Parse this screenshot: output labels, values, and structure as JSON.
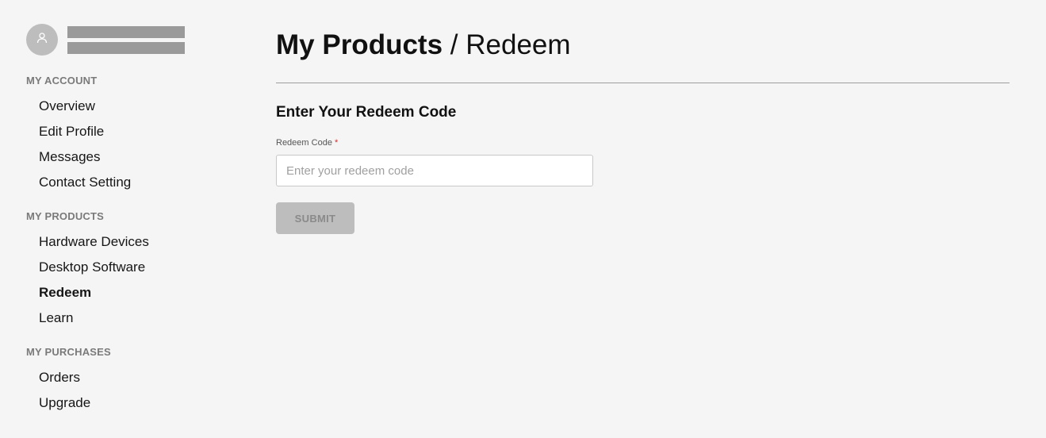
{
  "header": {
    "title_primary": "My Products",
    "title_separator": " / ",
    "title_secondary": "Redeem"
  },
  "sidebar": {
    "user": {
      "avatar_icon": "user-icon"
    },
    "sections": [
      {
        "heading": "MY ACCOUNT",
        "items": [
          {
            "label": "Overview"
          },
          {
            "label": "Edit Profile"
          },
          {
            "label": "Messages"
          },
          {
            "label": "Contact Setting"
          }
        ]
      },
      {
        "heading": "MY PRODUCTS",
        "items": [
          {
            "label": "Hardware Devices"
          },
          {
            "label": "Desktop Software"
          },
          {
            "label": "Redeem",
            "active": true
          },
          {
            "label": "Learn"
          }
        ]
      },
      {
        "heading": "MY PURCHASES",
        "items": [
          {
            "label": "Orders"
          },
          {
            "label": "Upgrade"
          }
        ]
      }
    ]
  },
  "form": {
    "title": "Enter Your Redeem Code",
    "field_label": "Redeem Code",
    "required_marker": "*",
    "placeholder": "Enter your redeem code",
    "value": "",
    "submit_label": "SUBMIT",
    "submit_disabled": true
  },
  "colors": {
    "background": "#f5f5f5",
    "required": "#d32f2f",
    "submit_disabled_bg": "#bdbdbd",
    "avatar_bg": "#bdbdbd"
  }
}
